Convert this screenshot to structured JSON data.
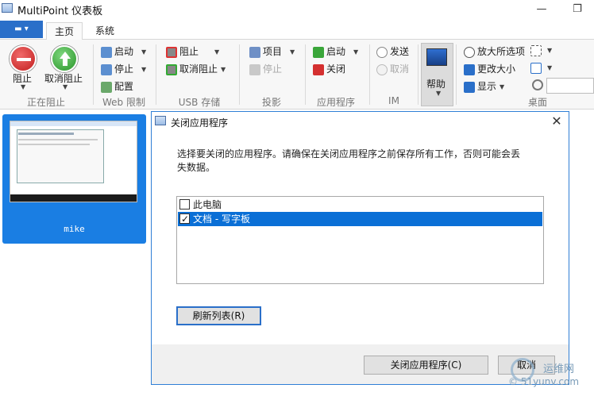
{
  "window": {
    "title": "MultiPoint 仪表板",
    "minimize": "—",
    "restore": "❐"
  },
  "ribbon": {
    "file_menu_glyph": "▬ ▾",
    "tabs": [
      {
        "label": "主页"
      },
      {
        "label": "系统"
      }
    ],
    "groups": {
      "blocking": {
        "label": "正在阻止",
        "block": "阻止",
        "unblock": "取消阻止"
      },
      "web": {
        "label": "Web 限制",
        "start": "启动",
        "stop": "停止",
        "configure": "配置"
      },
      "usb": {
        "label": "USB 存储",
        "block": "阻止",
        "unblock": "取消阻止"
      },
      "projection": {
        "label": "投影",
        "project": "项目",
        "stop": "停止"
      },
      "apps": {
        "label": "应用程序",
        "launch": "启动",
        "close": "关闭"
      },
      "im": {
        "label": "IM",
        "send": "发送",
        "cancel": "取消"
      },
      "help": {
        "label": "帮助"
      },
      "desktop": {
        "label": "桌面",
        "zoom_all": "放大所选项",
        "change_size": "更改大小",
        "display": "显示"
      }
    },
    "colors": {
      "accent": "#2a6fc9",
      "block_red": "#d43030",
      "unblock_green": "#3aa63a"
    }
  },
  "station": {
    "name": "mike"
  },
  "dialog": {
    "title": "关闭应用程序",
    "message": "选择要关闭的应用程序。请确保在关闭应用程序之前保存所有工作，否则可能会丢失数据。",
    "apps": [
      {
        "label": "此电脑",
        "checked": false,
        "selected": false
      },
      {
        "label": "文档 - 写字板",
        "checked": true,
        "selected": true
      }
    ],
    "refresh_button": "刷新列表(R)",
    "close_button": "关闭应用程序(C)",
    "cancel_button": "取消"
  },
  "watermark": {
    "line1": "运维网",
    "line2": "© 51yunv.com"
  }
}
